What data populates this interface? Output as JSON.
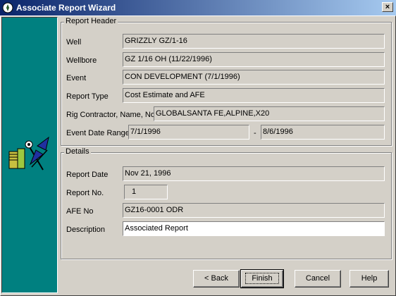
{
  "window": {
    "title": "Associate Report Wizard",
    "close_label": "×"
  },
  "sidebar": {
    "image_icon": "documents-and-satellite-icon"
  },
  "report_header": {
    "title": "Report Header",
    "well": {
      "label": "Well",
      "value": "GRIZZLY GZ/1-16"
    },
    "wellbore": {
      "label": "Wellbore",
      "value": "GZ 1/16 OH (11/22/1996)"
    },
    "event": {
      "label": "Event",
      "value": "CON DEVELOPMENT (7/1/1996)"
    },
    "report_type": {
      "label": "Report Type",
      "value": "Cost Estimate and AFE"
    },
    "rig_contractor": {
      "label": "Rig Contractor, Name, No",
      "value": "GLOBALSANTA FE,ALPINE,X20"
    },
    "event_date_range": {
      "label": "Event Date Range",
      "start": "7/1/1996",
      "separator": "-",
      "end": "8/6/1996"
    }
  },
  "details": {
    "title": "Details",
    "report_date": {
      "label": "Report Date",
      "value": "Nov 21, 1996"
    },
    "report_no": {
      "label": "Report No.",
      "value": "1"
    },
    "afe_no": {
      "label": "AFE No",
      "value": "GZ16-0001 ODR"
    },
    "description": {
      "label": "Description",
      "value": "Associated Report"
    }
  },
  "buttons": {
    "back": "< Back",
    "finish": "Finish",
    "cancel": "Cancel",
    "help": "Help"
  },
  "colors": {
    "title_start": "#0a246a",
    "title_end": "#a6caf0",
    "side_panel": "#008080",
    "face": "#d4d0c8"
  }
}
